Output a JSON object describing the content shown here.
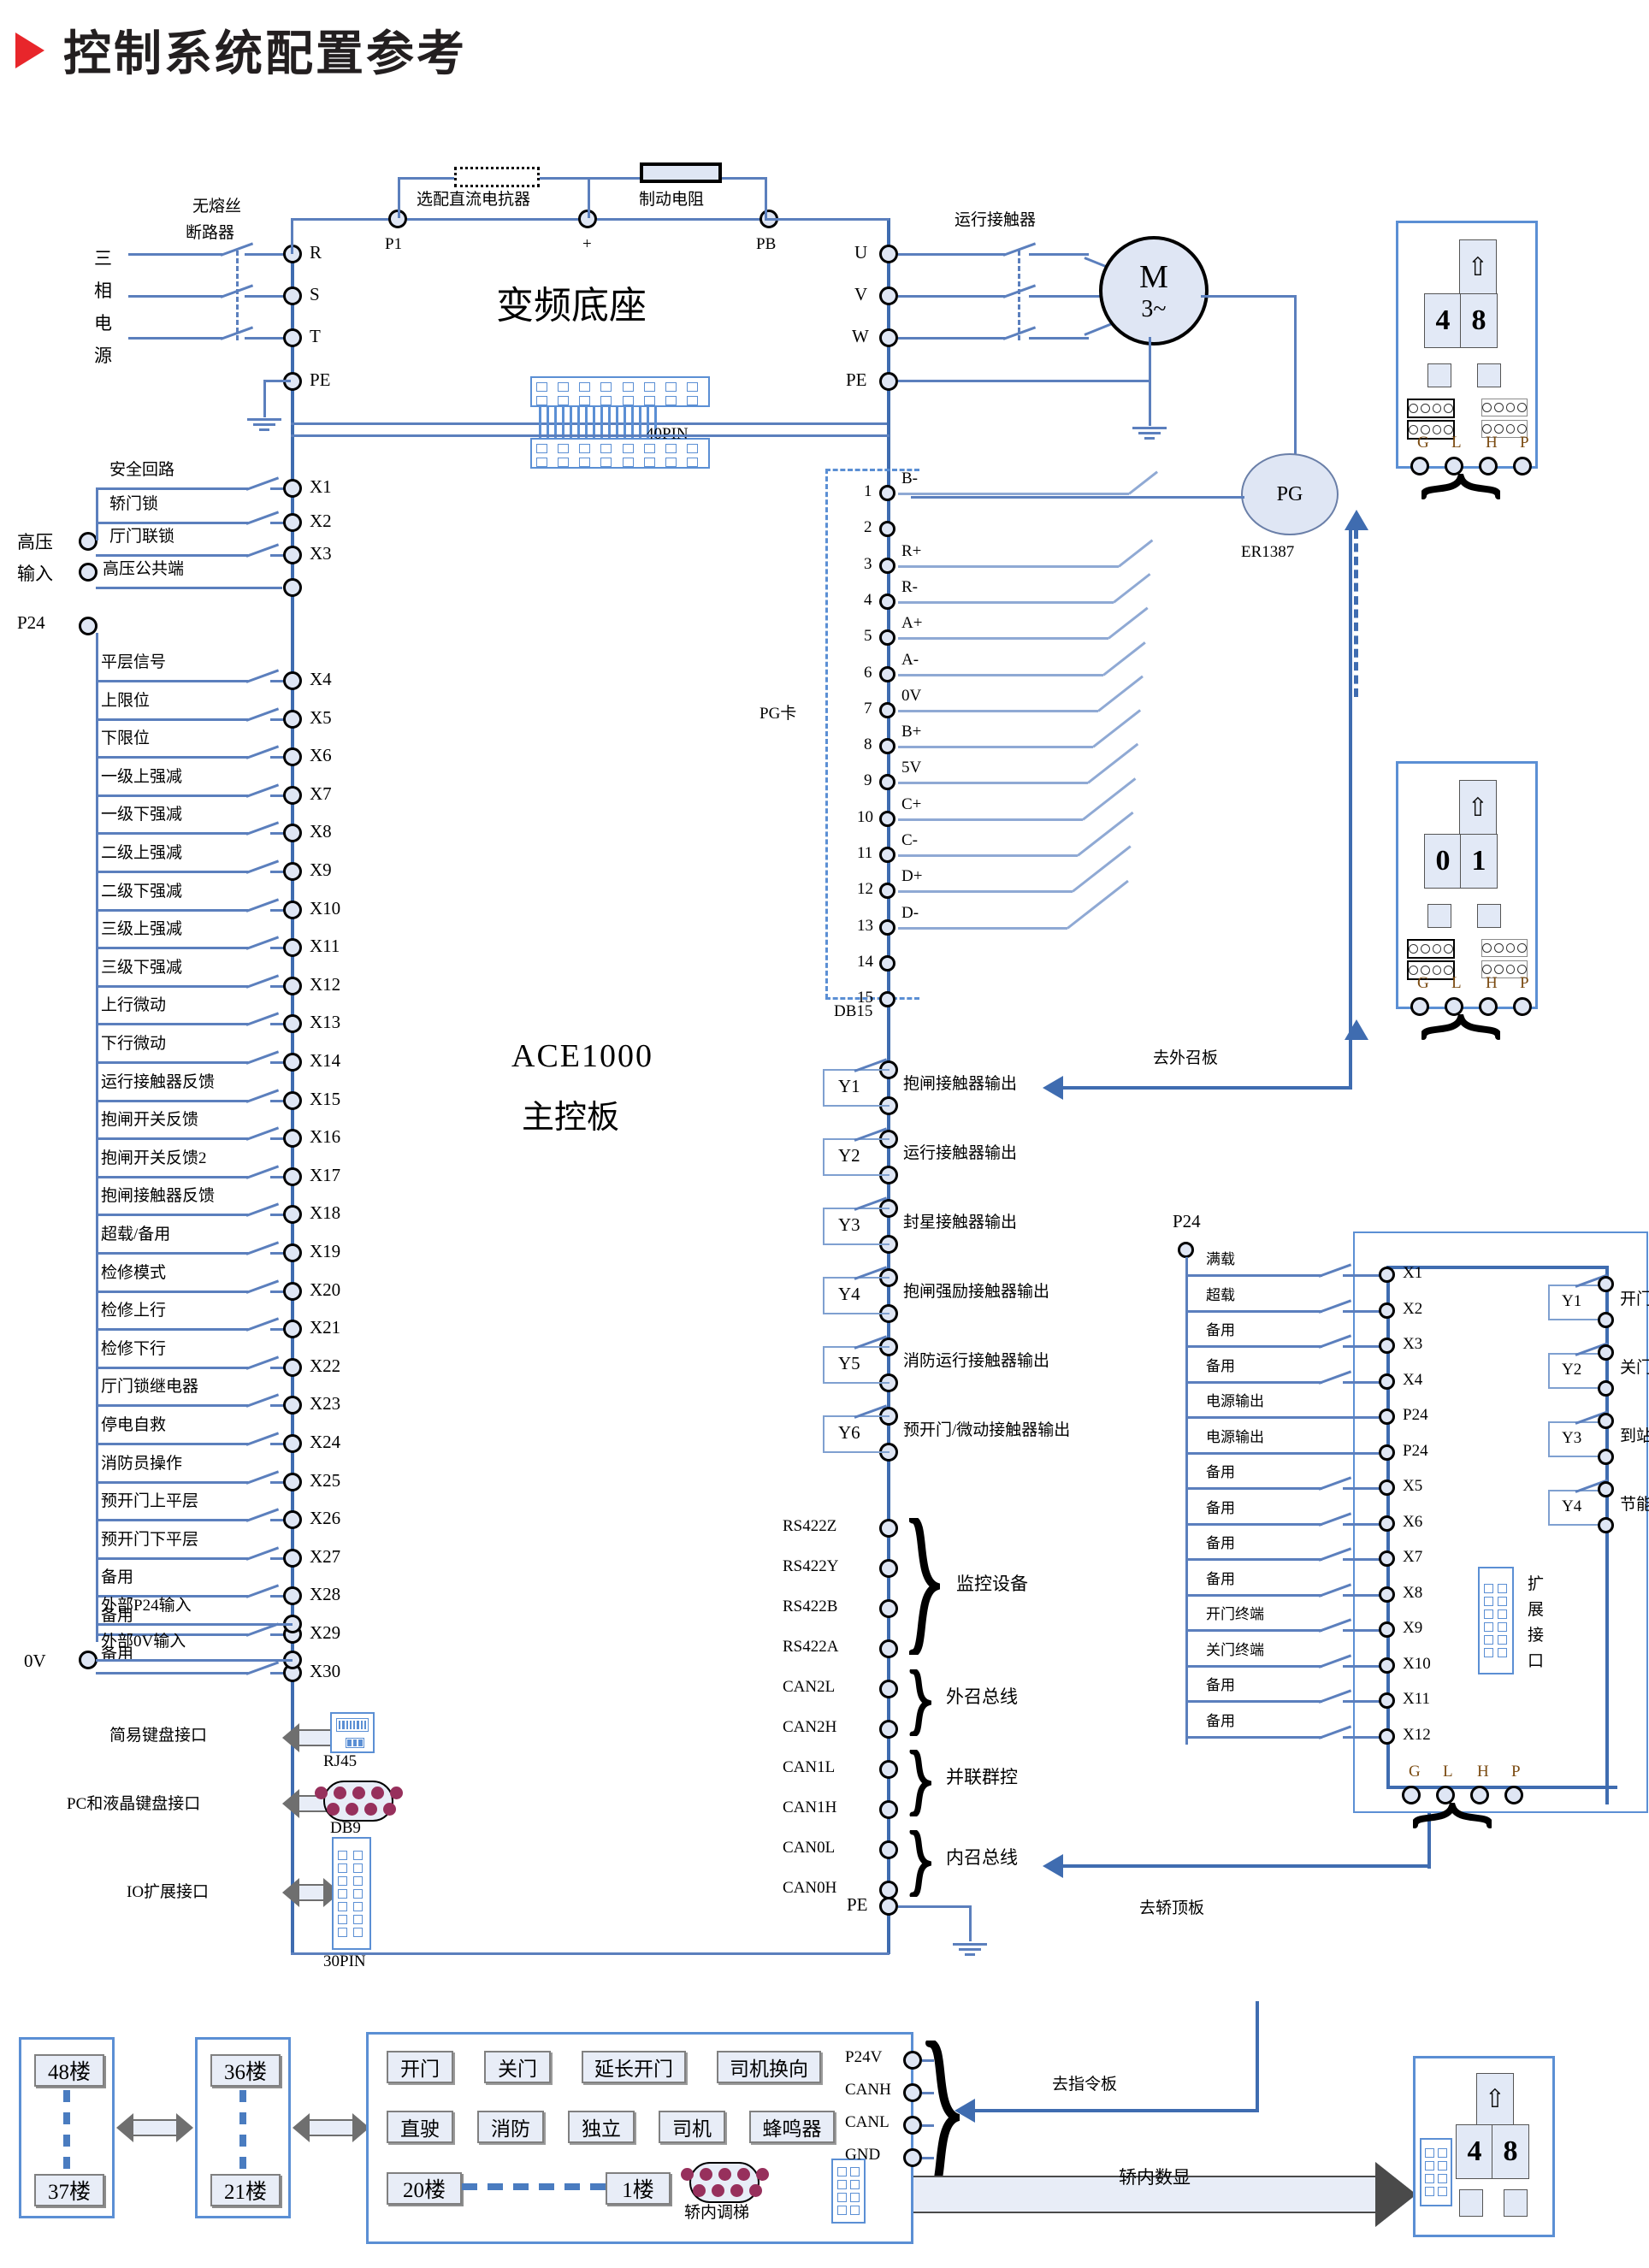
{
  "title": "控制系统配置参考",
  "power_input": {
    "source_label": [
      "三",
      "相",
      "电",
      "源"
    ],
    "breaker_label": [
      "无熔丝",
      "断路器"
    ],
    "terminals": [
      "R",
      "S",
      "T",
      "PE"
    ]
  },
  "drive": {
    "name": "变频底座",
    "dc_reactor_label": "选配直流电抗器",
    "brake_resistor_label": "制动电阻",
    "dc_terminals": [
      "P1",
      "+",
      "PB"
    ],
    "motor_terminals": [
      "U",
      "V",
      "W",
      "PE"
    ],
    "run_contactor_label": "运行接触器",
    "motor_symbol": "M",
    "motor_phase": "3~",
    "encoder_symbol": "PG",
    "encoder_model": "ER1387",
    "connector_40pin": "40PIN"
  },
  "main_board": {
    "name_line1": "ACE1000",
    "name_line2": "主控板",
    "hv_input_label": [
      "高压",
      "输入"
    ],
    "p24_label": "P24",
    "zero_v_label": "0V",
    "hv_inputs": [
      {
        "label": "安全回路",
        "terminal": "X1",
        "switch": true
      },
      {
        "label": "轿门锁",
        "terminal": "X2",
        "switch": true
      },
      {
        "label": "厅门联锁",
        "terminal": "X3",
        "switch": true
      },
      {
        "label": "高压公共端",
        "terminal": "",
        "switch": false
      }
    ],
    "inputs": [
      {
        "label": "平层信号",
        "terminal": "X4"
      },
      {
        "label": "上限位",
        "terminal": "X5"
      },
      {
        "label": "下限位",
        "terminal": "X6"
      },
      {
        "label": "一级上强减",
        "terminal": "X7"
      },
      {
        "label": "一级下强减",
        "terminal": "X8"
      },
      {
        "label": "二级上强减",
        "terminal": "X9"
      },
      {
        "label": "二级下强减",
        "terminal": "X10"
      },
      {
        "label": "三级上强减",
        "terminal": "X11"
      },
      {
        "label": "三级下强减",
        "terminal": "X12"
      },
      {
        "label": "上行微动",
        "terminal": "X13"
      },
      {
        "label": "下行微动",
        "terminal": "X14"
      },
      {
        "label": "运行接触器反馈",
        "terminal": "X15"
      },
      {
        "label": "抱闸开关反馈",
        "terminal": "X16"
      },
      {
        "label": "抱闸开关反馈2",
        "terminal": "X17"
      },
      {
        "label": "抱闸接触器反馈",
        "terminal": "X18"
      },
      {
        "label": "超载/备用",
        "terminal": "X19"
      },
      {
        "label": "检修模式",
        "terminal": "X20"
      },
      {
        "label": "检修上行",
        "terminal": "X21"
      },
      {
        "label": "检修下行",
        "terminal": "X22"
      },
      {
        "label": "厅门锁继电器",
        "terminal": "X23"
      },
      {
        "label": "停电自救",
        "terminal": "X24"
      },
      {
        "label": "消防员操作",
        "terminal": "X25"
      },
      {
        "label": "预开门上平层",
        "terminal": "X26"
      },
      {
        "label": "预开门下平层",
        "terminal": "X27"
      },
      {
        "label": "备用",
        "terminal": "X28"
      },
      {
        "label": "备用",
        "terminal": "X29"
      },
      {
        "label": "备用",
        "terminal": "X30"
      }
    ],
    "power_terminals": [
      {
        "label": "外部P24输入"
      },
      {
        "label": "外部0V输入"
      }
    ],
    "interfaces": [
      {
        "label": "简易键盘接口",
        "connector": "RJ45"
      },
      {
        "label": "PC和液晶键盘接口",
        "connector": "DB9"
      },
      {
        "label": "IO扩展接口",
        "connector": "30PIN"
      }
    ],
    "pg_card": {
      "label": "PG卡",
      "connector": "DB15",
      "pins": [
        {
          "no": "1",
          "signal": "B-"
        },
        {
          "no": "2",
          "signal": ""
        },
        {
          "no": "3",
          "signal": "R+"
        },
        {
          "no": "4",
          "signal": "R-"
        },
        {
          "no": "5",
          "signal": "A+"
        },
        {
          "no": "6",
          "signal": "A-"
        },
        {
          "no": "7",
          "signal": "0V"
        },
        {
          "no": "8",
          "signal": "B+"
        },
        {
          "no": "9",
          "signal": "5V"
        },
        {
          "no": "10",
          "signal": "C+"
        },
        {
          "no": "11",
          "signal": "C-"
        },
        {
          "no": "12",
          "signal": "D+"
        },
        {
          "no": "13",
          "signal": "D-"
        },
        {
          "no": "14",
          "signal": ""
        },
        {
          "no": "15",
          "signal": ""
        }
      ]
    },
    "outputs": [
      {
        "relay": "Y1",
        "label": "抱闸接触器输出"
      },
      {
        "relay": "Y2",
        "label": "运行接触器输出"
      },
      {
        "relay": "Y3",
        "label": "封星接触器输出"
      },
      {
        "relay": "Y4",
        "label": "抱闸强励接触器输出"
      },
      {
        "relay": "Y5",
        "label": "消防运行接触器输出"
      },
      {
        "relay": "Y6",
        "label": "预开门/微动接触器输出"
      }
    ],
    "comm": {
      "signals": [
        "RS422Z",
        "RS422Y",
        "RS422B",
        "RS422A",
        "CAN2L",
        "CAN2H",
        "CAN1L",
        "CAN1H",
        "CAN0L",
        "CAN0H"
      ],
      "groups": [
        {
          "label": "监控设备"
        },
        {
          "label": "外召总线"
        },
        {
          "label": "并联群控"
        },
        {
          "label": "内召总线"
        }
      ],
      "pe_label": "PE"
    }
  },
  "car_top_board": {
    "p24_label": "P24",
    "inputs": [
      {
        "label": "满载",
        "terminal": "X1"
      },
      {
        "label": "超载",
        "terminal": "X2"
      },
      {
        "label": "备用",
        "terminal": "X3"
      },
      {
        "label": "备用",
        "terminal": "X4"
      },
      {
        "label": "电源输出",
        "terminal": "P24"
      },
      {
        "label": "电源输出",
        "terminal": "P24"
      },
      {
        "label": "备用",
        "terminal": "X5"
      },
      {
        "label": "备用",
        "terminal": "X6"
      },
      {
        "label": "备用",
        "terminal": "X7"
      },
      {
        "label": "备用",
        "terminal": "X8"
      },
      {
        "label": "开门终端",
        "terminal": "X9"
      },
      {
        "label": "关门终端",
        "terminal": "X10"
      },
      {
        "label": "备用",
        "terminal": "X11"
      },
      {
        "label": "备用",
        "terminal": "X12"
      }
    ],
    "outputs": [
      {
        "relay": "Y1",
        "label": "开门"
      },
      {
        "relay": "Y2",
        "label": "关门"
      },
      {
        "relay": "Y3",
        "label": "到站钟"
      },
      {
        "relay": "Y4",
        "label": "节能"
      }
    ],
    "expansion_label": "扩展接口",
    "bus_terminals": [
      "G",
      "L",
      "H",
      "P"
    ]
  },
  "hall_displays": [
    {
      "digits": [
        "4",
        "8"
      ],
      "terminals": [
        "G",
        "L",
        "H",
        "P"
      ]
    },
    {
      "digits": [
        "0",
        "1"
      ],
      "terminals": [
        "G",
        "L",
        "H",
        "P"
      ]
    }
  ],
  "car_display": {
    "digits": [
      "4",
      "8"
    ]
  },
  "cop_panel": {
    "buttons_row1": [
      "开门",
      "关门",
      "延长开门",
      "司机换向"
    ],
    "buttons_row2": [
      "直驶",
      "消防",
      "独立",
      "司机",
      "蜂鸣器"
    ],
    "floor_range": [
      "20楼",
      "1楼"
    ],
    "service_connector": "轿内调梯",
    "terminals": [
      "P24V",
      "CANH",
      "CANL",
      "GND"
    ]
  },
  "floor_groups": [
    {
      "top": "48楼",
      "bottom": "37楼"
    },
    {
      "top": "36楼",
      "bottom": "21楼"
    }
  ],
  "annotations": {
    "to_hall_board": "去外召板",
    "to_car_top_board": "去轿顶板",
    "to_command_board": "去指令板",
    "car_display_arrow": "轿内数显"
  },
  "colors": {
    "wire": "#5b7fbd",
    "wire_bus": "#3f6cb0",
    "accent_red": "#e8262b",
    "terminal_fill": "#dfe6f4"
  }
}
